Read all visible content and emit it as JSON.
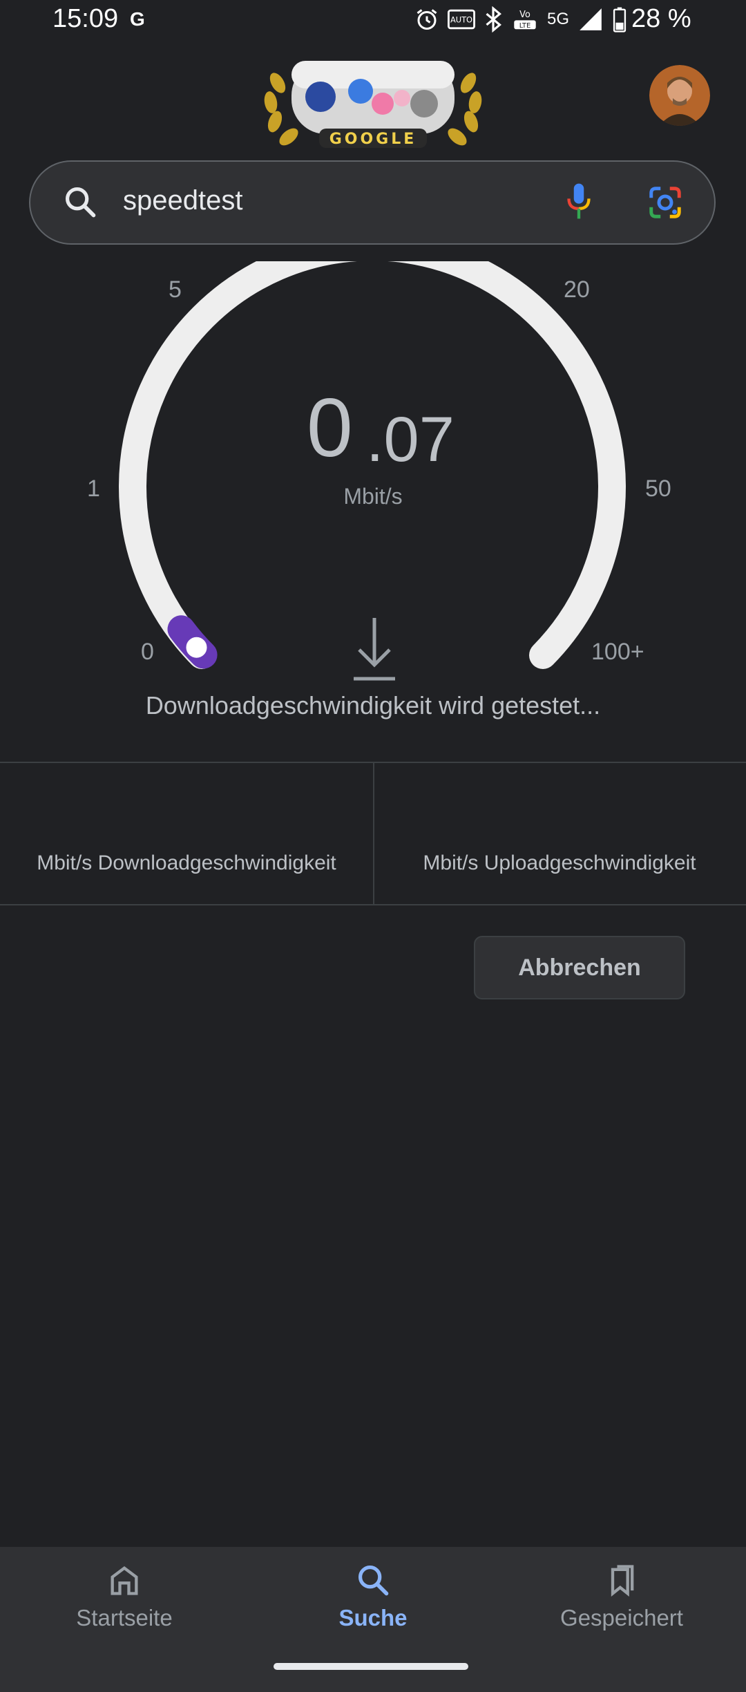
{
  "status_bar": {
    "time": "15:09",
    "carrier_glyph": "G",
    "network": "5G",
    "battery_text": "28 %",
    "icons": [
      "alarm-icon",
      "auto-hz-icon",
      "bluetooth-icon",
      "volte-icon",
      "5g-icon",
      "signal-icon",
      "battery-icon"
    ]
  },
  "header": {
    "doodle_name": "google-doodle",
    "doodle_text": "GOOGLE",
    "avatar": "profile-avatar"
  },
  "search": {
    "query": "speedtest",
    "icons": [
      "search-icon",
      "microphone-icon",
      "google-lens-icon"
    ]
  },
  "speedtest": {
    "ticks": {
      "t0": "0",
      "t1": "1",
      "t5": "5",
      "t20": "20",
      "t50": "50",
      "t100": "100+"
    },
    "speed_integer": "0",
    "speed_decimal": ".07",
    "unit": "Mbit/s",
    "status_message": "Downloadgeschwindigkeit wird getestet...",
    "progress_fraction": 0.03,
    "accent_color": "#673ab7",
    "track_color": "#eeeeee"
  },
  "results": {
    "download_label": "Mbit/s Downloadgeschwindigkeit",
    "upload_label": "Mbit/s Uploadgeschwindigkeit"
  },
  "actions": {
    "cancel_label": "Abbrechen"
  },
  "bottom_nav": {
    "items": [
      {
        "label": "Startseite",
        "icon": "home-icon",
        "active": false
      },
      {
        "label": "Suche",
        "icon": "search-icon",
        "active": true
      },
      {
        "label": "Gespeichert",
        "icon": "saved-icon",
        "active": false
      }
    ],
    "active_color": "#8ab4f8"
  }
}
